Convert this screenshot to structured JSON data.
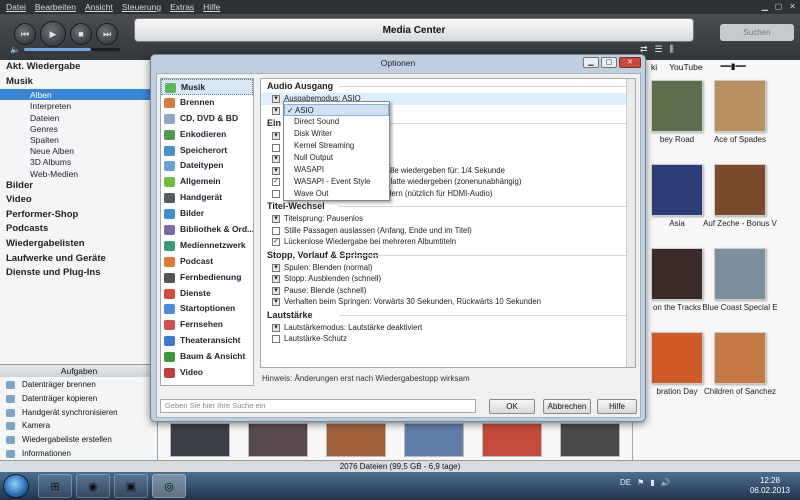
{
  "menu": [
    "Datei",
    "Bearbeiten",
    "Ansicht",
    "Steuerung",
    "Extras",
    "Hilfe"
  ],
  "app": {
    "title": "Media Center",
    "search_placeholder": "Suchen",
    "volume": 0.7
  },
  "sidebar": {
    "items": [
      {
        "label": "Akt. Wiedergabe",
        "level": 0
      },
      {
        "label": "Musik",
        "level": 0
      },
      {
        "label": "Alben",
        "level": 1,
        "selected": true
      },
      {
        "label": "Interpreten",
        "level": 1
      },
      {
        "label": "Dateien",
        "level": 1
      },
      {
        "label": "Genres",
        "level": 1
      },
      {
        "label": "Spalten",
        "level": 1
      },
      {
        "label": "Neue Alben",
        "level": 1
      },
      {
        "label": "3D Albums",
        "level": 1
      },
      {
        "label": "Web-Medien",
        "level": 1
      },
      {
        "label": "Bilder",
        "level": 0
      },
      {
        "label": "Video",
        "level": 0
      },
      {
        "label": "Performer-Shop",
        "level": 0
      },
      {
        "label": "Podcasts",
        "level": 0
      },
      {
        "label": "Wiedergabelisten",
        "level": 0
      },
      {
        "label": "Laufwerke und Geräte",
        "level": 0
      },
      {
        "label": "Dienste und Plug-Ins",
        "level": 0
      }
    ]
  },
  "tasks": {
    "header": "Aufgaben",
    "items": [
      "Datenträger brennen",
      "Datenträger kopieren",
      "Handgerät synchronisieren",
      "Kamera",
      "Wiedergabeliste erstellen",
      "Informationen"
    ]
  },
  "albumgrid": {
    "tabs": [
      "ki",
      "YouTube"
    ],
    "albums": [
      {
        "title": "bey Road",
        "color": "#5f6e4c"
      },
      {
        "title": "Ace of Spades",
        "color": "#b99060"
      },
      {
        "title": "Asia",
        "color": "#2b3e7a"
      },
      {
        "title": "Auf Zeche - Bonus V",
        "color": "#7a4a2a"
      },
      {
        "title": "on the Tracks",
        "color": "#3b2a28"
      },
      {
        "title": "Blue Coast Special E",
        "color": "#7b8f9e"
      },
      {
        "title": "bration Day",
        "color": "#d05a24"
      },
      {
        "title": "Children of Sanchez",
        "color": "#c47a42"
      }
    ],
    "bottom_covers": [
      "#3c3f46",
      "#5a4a50",
      "#a0603a",
      "#5e7ea8",
      "#c44a3a",
      "#4a4a4a"
    ]
  },
  "status": "2076 Dateien (99,5 GB - 6,9 tage)",
  "taskbar": {
    "apps": [
      "⊞",
      "◉",
      "▣",
      "◎"
    ],
    "tray_lang": "DE",
    "time": "12:28",
    "date": "06.02.2013"
  },
  "dialog": {
    "title": "Optionen",
    "categories": [
      {
        "label": "Musik",
        "color": "#5cb85c",
        "selected": true
      },
      {
        "label": "Brennen",
        "color": "#d87a3a"
      },
      {
        "label": "CD, DVD & BD",
        "color": "#8da7c6"
      },
      {
        "label": "Enkodieren",
        "color": "#4f9a4f"
      },
      {
        "label": "Speicherort",
        "color": "#4a90d0"
      },
      {
        "label": "Dateitypen",
        "color": "#6aa0d8"
      },
      {
        "label": "Allgemein",
        "color": "#6fbf3a"
      },
      {
        "label": "Handgerät",
        "color": "#555a5e"
      },
      {
        "label": "Bilder",
        "color": "#3e8ed0"
      },
      {
        "label": "Bibliothek & Ord...",
        "color": "#7a6aa8"
      },
      {
        "label": "Mediennetzwerk",
        "color": "#3a9a7a"
      },
      {
        "label": "Podcast",
        "color": "#e07a30"
      },
      {
        "label": "Fernbedienung",
        "color": "#555555"
      },
      {
        "label": "Dienste",
        "color": "#d84a3a"
      },
      {
        "label": "Startoptionen",
        "color": "#4a8ad8"
      },
      {
        "label": "Fernsehen",
        "color": "#d05050"
      },
      {
        "label": "Theateransicht",
        "color": "#3a7ad0"
      },
      {
        "label": "Baum & Ansicht",
        "color": "#3a9a3a"
      },
      {
        "label": "Video",
        "color": "#c04040"
      }
    ],
    "sections": {
      "audio": {
        "title": "Audio Ausgang",
        "ausgabemodus": "Ausgabemodus: ASIO",
        "partial_header": "Ein",
        "opt_a": "he Stille wiedergeben für: 1/4 Sekunde",
        "opt_b": "Festplatte wiedergeben (zonenunabhängig)",
        "opt_c": "Bildschirm ausschalten verhindern (nützlich für HDMI-Audio)"
      },
      "titelwechsel": {
        "title": "Titel-Wechsel",
        "items": [
          "Titelsprung: Pausenlos",
          "Stille Passagen auslassen (Anfang, Ende und im Titel)",
          "Lückenlose Wiedergabe bei mehreren Albumtiteln"
        ]
      },
      "stopp": {
        "title": "Stopp, Vorlauf & Springen",
        "items": [
          "Spulen: Blenden (normal)",
          "Stopp: Ausblenden (schnell)",
          "Pause: Blende (schnell)",
          "Verhalten beim Springen: Vorwärts 30 Sekunden, Rückwärts 10 Sekunden"
        ]
      },
      "lautstaerke": {
        "title": "Lautstärke",
        "items": [
          "Lautstärkemodus: Lautstärke deaktiviert",
          "Lautstärke-Schutz"
        ]
      }
    },
    "hint": "Hinweis: Änderungen erst nach Wiedergabestopp wirksam",
    "search_placeholder": "Geben Sie hier Ihre Suche ein",
    "buttons": {
      "ok": "OK",
      "cancel": "Abbrechen",
      "help": "Hilfe"
    }
  },
  "dropdown": {
    "options": [
      "ASIO",
      "Direct Sound",
      "Disk Writer",
      "Kernel Streaming",
      "Null Output",
      "WASAPI",
      "WASAPI - Event Style",
      "Wave Out"
    ],
    "selected": "ASIO"
  }
}
